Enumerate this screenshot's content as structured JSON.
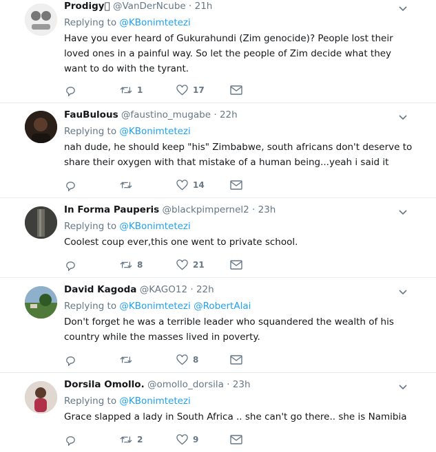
{
  "tweets": [
    {
      "name": "Prodigy🏻",
      "handle": "@VanDerNcube",
      "sep": "·",
      "time": "21h",
      "replying_label": "Replying to",
      "replying_to": [
        "@KBonimtetezi"
      ],
      "text": "Have you ever heard of Gukurahundi (Zim genocide)? People lost their loved ones in a painful way. So let the people of Zim decide what they want to do with the tyrant.",
      "retweets": "1",
      "likes": "17",
      "avatar_color": "#d9d9d9"
    },
    {
      "name": "FauBulous",
      "handle": "@faustino_mugabe",
      "sep": "·",
      "time": "22h",
      "replying_label": "Replying to",
      "replying_to": [
        "@KBonimtetezi"
      ],
      "text": "nah dude, he should keep \"his\" Zimbabwe, south africans don't deserve to share their oxygen with that mistake of a human being...yeah i said it",
      "retweets": "",
      "likes": "14",
      "avatar_color": "#3a2a22"
    },
    {
      "name": "In Forma Pauperis",
      "handle": "@blackpimpernel2",
      "sep": "·",
      "time": "23h",
      "replying_label": "Replying to",
      "replying_to": [
        "@KBonimtetezi"
      ],
      "text": "Coolest coup ever,this one went to private school.",
      "retweets": "8",
      "likes": "21",
      "avatar_color": "#4a4a44"
    },
    {
      "name": "David Kagoda",
      "handle": "@KAGO12",
      "sep": "·",
      "time": "22h",
      "replying_label": "Replying to",
      "replying_to": [
        "@KBonimtetezi",
        "@RobertAlai"
      ],
      "text": "Don't forget he was a terrible leader who squandered the wealth of his country while the masses lived in poverty.",
      "retweets": "",
      "likes": "8",
      "avatar_color": "#5f7d4a"
    },
    {
      "name": "Dorsila Omollo.",
      "handle": "@omollo_dorsila",
      "sep": "·",
      "time": "23h",
      "replying_label": "Replying to",
      "replying_to": [
        "@KBonimtetezi"
      ],
      "text": "Grace slapped a lady in South Africa .. she can't go there.. she is Namibia",
      "retweets": "2",
      "likes": "9",
      "avatar_color": "#c9b7a8"
    }
  ],
  "colors": {
    "accent": "#1da1f2",
    "muted": "#657786",
    "text": "#14171a",
    "divider": "#e6ecf0"
  },
  "icons": [
    "reply-icon",
    "retweet-icon",
    "like-icon",
    "direct-message-icon",
    "chevron-down-icon"
  ]
}
